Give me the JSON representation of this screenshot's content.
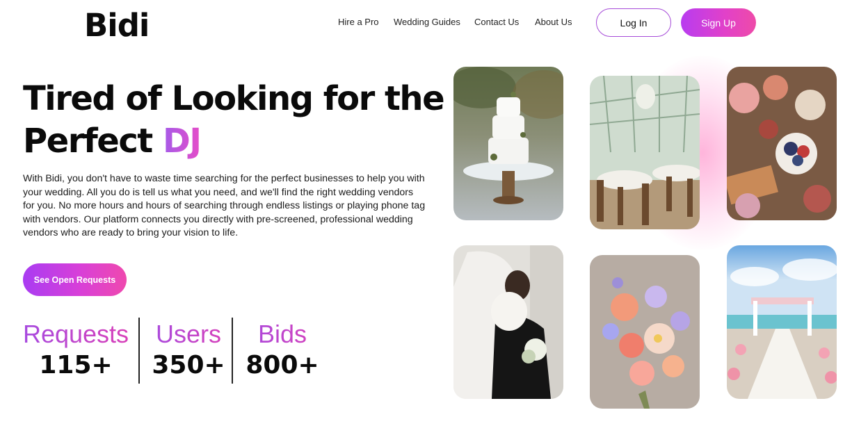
{
  "brand": {
    "logo": "Bidi"
  },
  "nav": {
    "items": [
      {
        "label": "Hire a Pro"
      },
      {
        "label": "Wedding Guides"
      },
      {
        "label": "Contact Us"
      },
      {
        "label": "About Us"
      }
    ],
    "login_label": "Log In",
    "signup_label": "Sign Up"
  },
  "hero": {
    "headline_line1": "Tired of Looking for the",
    "headline_line2_prefix": "Perfect ",
    "headline_accent": "DJ",
    "description": "With Bidi, you don't have to waste time searching for the perfect businesses to help you with your wedding. All you do is tell us what you need, and we'll find the right wedding vendors for you. No more hours and hours of searching through endless listings or playing phone tag with vendors. Our platform connects you directly with pre-screened, professional wedding vendors who are ready to bring your vision to life.",
    "cta_label": "See Open Requests"
  },
  "stats": [
    {
      "label": "Requests",
      "value": "115+"
    },
    {
      "label": "Users",
      "value": "350+"
    },
    {
      "label": "Bids",
      "value": "800+"
    }
  ],
  "gallery": [
    {
      "subject": "wedding-cake"
    },
    {
      "subject": "greenhouse-reception"
    },
    {
      "subject": "grazing-table"
    },
    {
      "subject": "couple-embrace"
    },
    {
      "subject": "floral-bouquet"
    },
    {
      "subject": "beach-ceremony-arch"
    }
  ],
  "colors": {
    "accent_purple": "#a93cf2",
    "accent_pink": "#ef49ae",
    "text_dark": "#0a0a0a"
  }
}
